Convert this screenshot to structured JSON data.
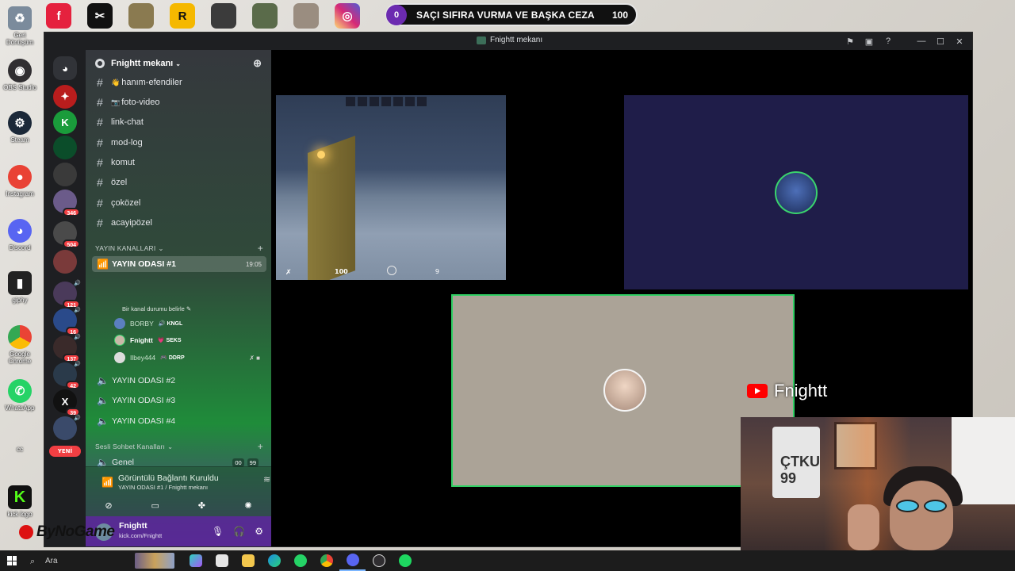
{
  "desktop": {
    "icons": [
      {
        "label": "Geri\nDönüşüm",
        "icon": "recycle-bin-icon",
        "color": "#7b8b9c"
      },
      {
        "label": "OBS Studio",
        "icon": "obs-icon",
        "color": "#302e31"
      },
      {
        "label": "Steam",
        "icon": "steam-icon",
        "color": "#1b2838"
      },
      {
        "label": "Instagram",
        "icon": "chrome-instagram-icon",
        "color": "#e94235"
      },
      {
        "label": "Discord",
        "icon": "discord-icon",
        "color": "#5865f2"
      },
      {
        "label": "giphy",
        "icon": "giphy-icon",
        "color": "#222"
      },
      {
        "label": "Google\nChrome",
        "icon": "chrome-icon",
        "color": "#34a853"
      },
      {
        "label": "WhatsApp",
        "icon": "whatsapp-icon",
        "color": "#25d366"
      },
      {
        "label": "cc",
        "icon": "blank-icon",
        "color": "transparent"
      },
      {
        "label": "kick logo",
        "icon": "kick-icon",
        "color": "#53fc18"
      }
    ],
    "top_apps": [
      {
        "icon": "faceit-icon",
        "color": "#e5213e",
        "glyph": "f"
      },
      {
        "icon": "capcut-icon",
        "color": "#111",
        "glyph": "✂"
      },
      {
        "icon": "game-icon",
        "color": "#8a7a50",
        "glyph": ""
      },
      {
        "icon": "rockstar-icon",
        "color": "#f5b800",
        "glyph": "R"
      },
      {
        "icon": "game2-icon",
        "color": "#3b3b3b",
        "glyph": ""
      },
      {
        "icon": "game3-icon",
        "color": "#5a6b4a",
        "glyph": ""
      },
      {
        "icon": "game4-icon",
        "color": "#9a8d80",
        "glyph": ""
      },
      {
        "icon": "instagram-icon",
        "color": "#d62976",
        "glyph": "◎"
      }
    ],
    "banner": {
      "badge": "0",
      "text": "SAÇI SIFIRA VURMA VE BAŞKA CEZA",
      "value": "100"
    },
    "watermark": "ByNoGame",
    "youtube_name": "Fnightt",
    "webcam_shirt": "ÇTKU\n99"
  },
  "window": {
    "title": "Fnightt mekanı"
  },
  "servers": [
    {
      "color": "#5865f2",
      "glyph": "◎",
      "badge": ""
    },
    {
      "color": "#b91d1d",
      "glyph": "✦",
      "badge": ""
    },
    {
      "color": "#1a9c3b",
      "glyph": "K",
      "badge": ""
    },
    {
      "color": "#0b4d2a",
      "glyph": "",
      "badge": ""
    },
    {
      "color": "#3a3a3a",
      "glyph": "",
      "badge": ""
    },
    {
      "color": "#6b5b8a",
      "glyph": "",
      "badge": "346"
    },
    {
      "color": "#4a4a4a",
      "glyph": "",
      "badge": "504"
    },
    {
      "color": "#7a3a3a",
      "glyph": "",
      "badge": ""
    },
    {
      "color": "#4a3a5a",
      "glyph": "",
      "badge": "121"
    },
    {
      "color": "#2a4a8a",
      "glyph": "",
      "badge": "16"
    },
    {
      "color": "#3a2a2a",
      "glyph": "",
      "badge": "137"
    },
    {
      "color": "#2a3a4a",
      "glyph": "",
      "badge": "42"
    },
    {
      "color": "#111",
      "glyph": "X",
      "badge": "39"
    },
    {
      "color": "#3a4a6a",
      "glyph": "",
      "badge": ""
    }
  ],
  "new_label": "YENİ",
  "guild": {
    "name": "Fnightt mekanı"
  },
  "text_channels": [
    {
      "emoji": "👋",
      "name": "hanım-efendiler"
    },
    {
      "emoji": "📷",
      "name": "foto-video"
    },
    {
      "emoji": "",
      "name": "link-chat"
    },
    {
      "emoji": "",
      "name": "mod-log"
    },
    {
      "emoji": "",
      "name": "komut"
    },
    {
      "emoji": "",
      "name": "özel"
    },
    {
      "emoji": "",
      "name": "çoközel"
    },
    {
      "emoji": "",
      "name": "acayipözel"
    }
  ],
  "categories": {
    "stream": "YAYIN KANALLARI",
    "voice": "Sesli Sohbet Kanalları"
  },
  "active_voice": {
    "name": "YAYIN ODASI #1",
    "time": "19:05",
    "status": "Bir kanal durumu belirle"
  },
  "voice_users": [
    {
      "name": "BORBY",
      "tag": "KNGL",
      "tag_icon": "🔊",
      "avatar": "#5b7fbf",
      "me": false
    },
    {
      "name": "Fnightt",
      "tag": "SEKS",
      "tag_icon": "💗",
      "avatar": "#c9b8a8",
      "me": true
    },
    {
      "name": "Ilbey444",
      "tag": "DDRP",
      "tag_icon": "🎮",
      "avatar": "#dcdcdc",
      "me": false
    }
  ],
  "voice_channels": [
    {
      "name": "YAYIN ODASI #2"
    },
    {
      "name": "YAYIN ODASI #3"
    },
    {
      "name": "YAYIN ODASI #4"
    }
  ],
  "general_channel": {
    "name": "Genel",
    "counts": [
      "00",
      "99"
    ]
  },
  "voice_panel": {
    "title": "Görüntülü Bağlantı Kuruldu",
    "subtitle": "YAYIN ODASI #1 / Fnightt mekanı"
  },
  "user_panel": {
    "name": "Fnightt",
    "status": "kick.com/Fnightt"
  },
  "game_hud": {
    "hp": "100",
    "ammo": "9"
  },
  "taskbar": {
    "search_placeholder": "Ara"
  }
}
